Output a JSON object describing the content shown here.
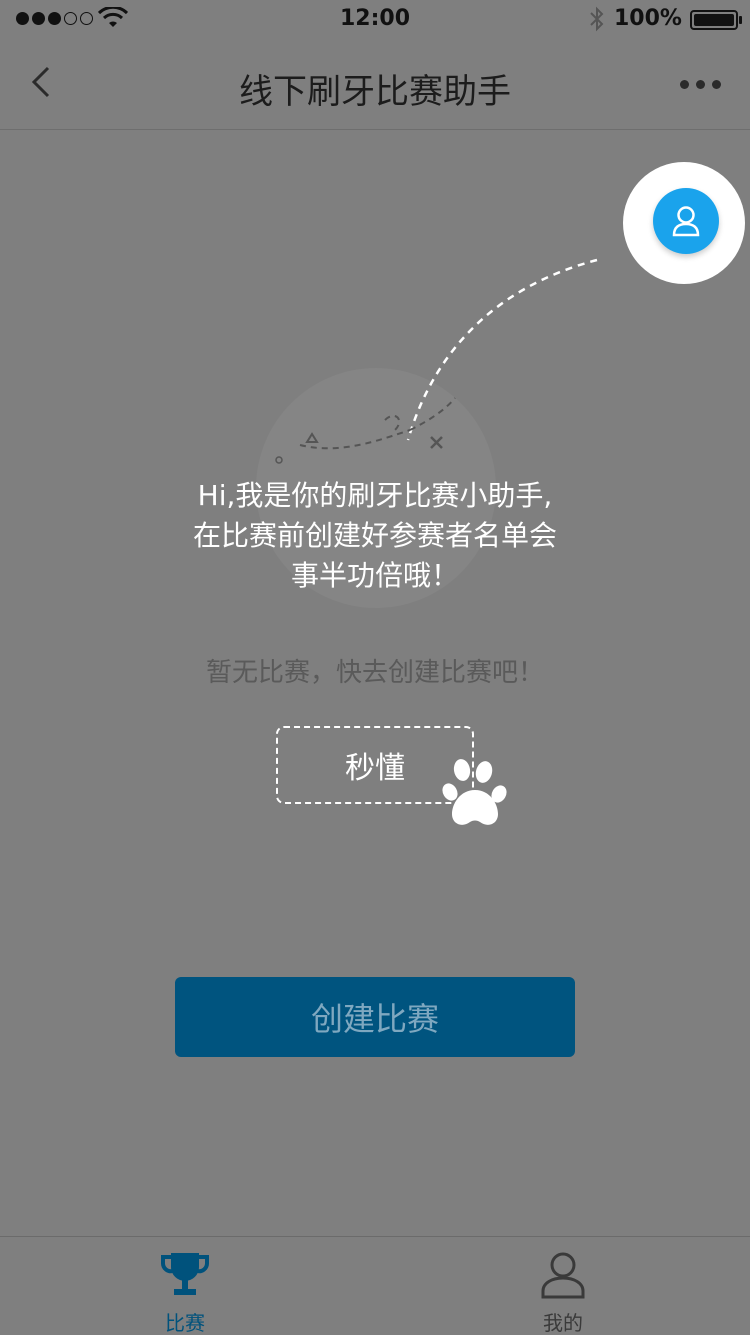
{
  "status_bar": {
    "time": "12:00",
    "battery_label": "100%",
    "battery_level": 1.0,
    "signal_bars_filled": 3,
    "signal_bars_total": 5
  },
  "nav": {
    "title": "线下刷牙比赛助手"
  },
  "main": {
    "empty_text": "暂无比赛，快去创建比赛吧！",
    "create_button": "创建比赛"
  },
  "tabs": [
    {
      "label": "比赛",
      "icon": "trophy-icon",
      "active": true
    },
    {
      "label": "我的",
      "icon": "user-icon",
      "active": false
    }
  ],
  "guide": {
    "line1": "Hi,我是你的刷牙比赛小助手,",
    "line2": "在比赛前创建好参赛者名单会",
    "line3": "事半功倍哦！",
    "got_it": "秒懂"
  },
  "colors": {
    "accent": "#1aa3ec",
    "button": "#00547f",
    "tab_active": "#00527c",
    "overlay": "#7f7f7f"
  }
}
